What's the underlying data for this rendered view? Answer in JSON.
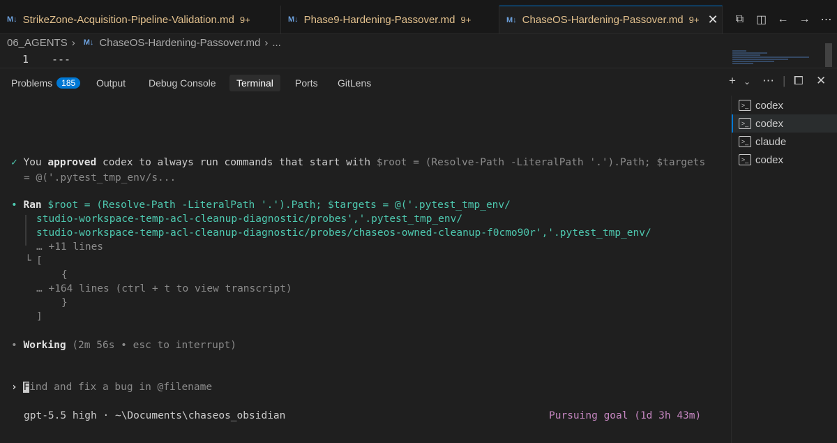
{
  "tabs": [
    {
      "label": "StrikeZone-Acquisition-Pipeline-Validation.md",
      "count": "9+",
      "icon": "M↓"
    },
    {
      "label": "Phase9-Hardening-Passover.md",
      "count": "9+",
      "icon": "M↓"
    },
    {
      "label": "ChaseOS-Hardening-Passover.md",
      "count": "9+",
      "icon": "M↓"
    }
  ],
  "breadcrumb": {
    "folder": "06_AGENTS",
    "file": "ChaseOS-Hardening-Passover.md",
    "more": "..."
  },
  "editor": {
    "line_number": "1",
    "line_text": "---"
  },
  "panel": {
    "problems_label": "Problems",
    "problems_count": "185",
    "output_label": "Output",
    "debug_label": "Debug Console",
    "terminal_label": "Terminal",
    "ports_label": "Ports",
    "gitlens_label": "GitLens"
  },
  "terminal": {
    "approved_prefix": "You ",
    "approved_bold": "approved",
    "approved_rest": " codex to always run commands that start with ",
    "approved_cmd": "$root = (Resolve-Path -LiteralPath '.').Path; $targets",
    "approved_cont": "= @('.pytest_tmp_env/s...",
    "ran_label": "Ran",
    "ran_line1": "$root = (Resolve-Path -LiteralPath '.').Path; $targets = @('.pytest_tmp_env/",
    "ran_line2": "studio-workspace-temp-acl-cleanup-diagnostic/probes','.pytest_tmp_env/",
    "ran_line3": "studio-workspace-temp-acl-cleanup-diagnostic/probes/chaseos-owned-cleanup-f0cmo90r','.pytest_tmp_env/",
    "more_lines": "… +11 lines",
    "bracket_open": "[",
    "brace_open": "{",
    "transcript": "… +164 lines (ctrl + t to view transcript)",
    "brace_close": "}",
    "bracket_close": "]",
    "working_label": "Working",
    "working_status": "(2m 56s • esc to interrupt)",
    "prompt_first": "F",
    "prompt_rest": "ind and fix a bug in @filename",
    "model": "gpt-5.5 high",
    "path": "· ~\\Documents\\chaseos_obsidian",
    "goal": "Pursuing goal (1d 3h 43m)"
  },
  "terminals": [
    "codex",
    "codex",
    "claude",
    "codex"
  ],
  "colors": {
    "accent": "#0078d4",
    "modified": "#e2c08d",
    "success": "#4ec9b0",
    "goal": "#c586c0"
  }
}
